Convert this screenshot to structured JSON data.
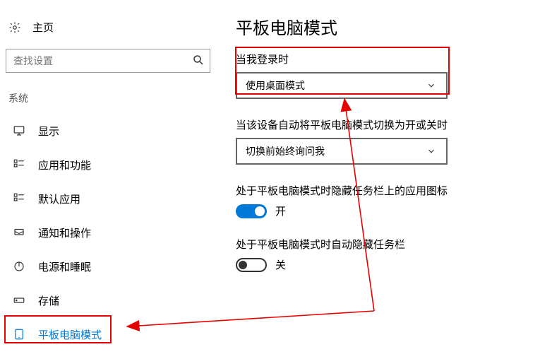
{
  "sidebar": {
    "home_label": "主页",
    "search_placeholder": "查找设置",
    "category_label": "系统",
    "items": [
      {
        "label": "显示"
      },
      {
        "label": "应用和功能"
      },
      {
        "label": "默认应用"
      },
      {
        "label": "通知和操作"
      },
      {
        "label": "电源和睡眠"
      },
      {
        "label": "存储"
      },
      {
        "label": "平板电脑模式"
      }
    ]
  },
  "main": {
    "title": "平板电脑模式",
    "login_label": "当我登录时",
    "login_value": "使用桌面模式",
    "switch_label": "当该设备自动将平板电脑模式切换为开或关时",
    "switch_value": "切换前始终询问我",
    "hide_icons_label": "处于平板电脑模式时隐藏任务栏上的应用图标",
    "hide_icons_state": "开",
    "hide_taskbar_label": "处于平板电脑模式时自动隐藏任务栏",
    "hide_taskbar_state": "关"
  }
}
